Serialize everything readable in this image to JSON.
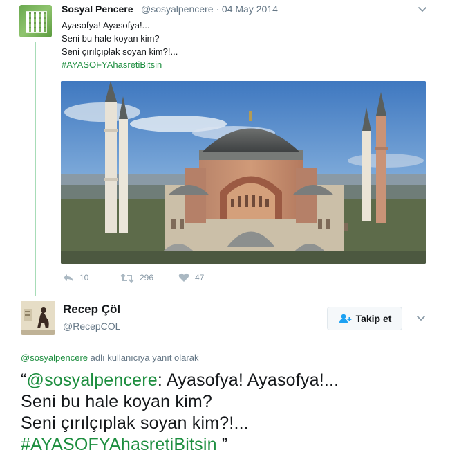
{
  "original_tweet": {
    "author_name": "Sosyal Pencere",
    "handle_and_date": "@sosyalpencere · 04 May 2014",
    "lines": [
      "Ayasofya! Ayasofya!...",
      "Seni bu hale koyan kim?",
      "Seni çırılçıplak soyan kim?!..."
    ],
    "hashtag": "#AYASOFYAhasretiBitsin",
    "image_icon": "hagia-sophia-photo",
    "reply_count": "10",
    "retweet_count": "296",
    "like_count": "47"
  },
  "reply_tweet": {
    "author_name": "Recep Çöl",
    "handle": "@RecepCOL",
    "follow_label": "Takip et",
    "reply_context_mention": "@sosyalpencere",
    "reply_context_text": " adlı kullanıcıya yanıt olarak",
    "quote_open": "“",
    "mention": "@sosyalpencere",
    "line1_rest": ": Ayasofya! Ayasofya!...",
    "line2": "Seni bu hale koyan kim?",
    "line3": "Seni çırılçıplak soyan kim?!...",
    "hashtag": "#AYASOFYAhasretiBitsin",
    "quote_close": " ”"
  },
  "colors": {
    "link": "#1d8e3f",
    "thread_line": "#a7dcb7",
    "muted": "#657786",
    "icon": "#8899a6"
  }
}
